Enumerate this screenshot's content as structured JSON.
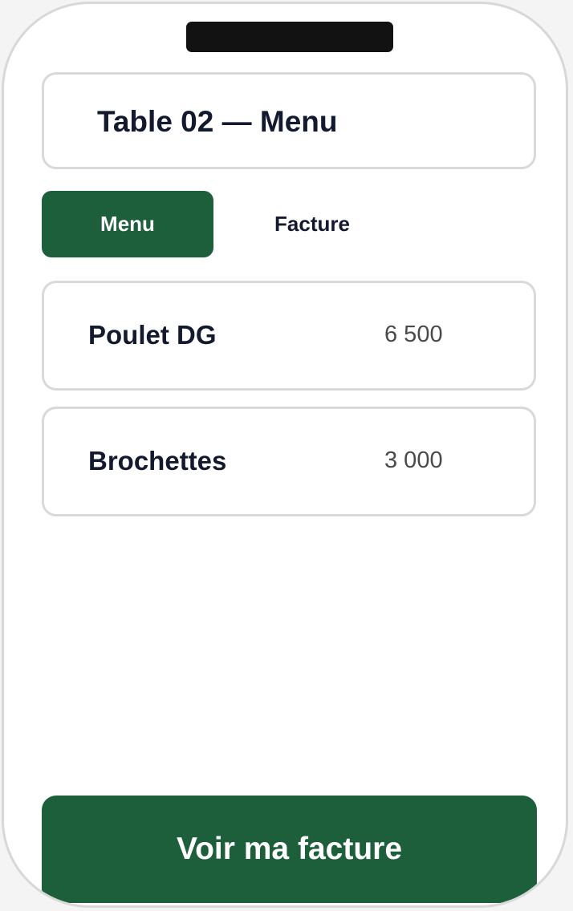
{
  "header": {
    "title": "Table 02 — Menu"
  },
  "tabs": [
    {
      "label": "Menu",
      "active": true
    },
    {
      "label": "Facture",
      "active": false
    }
  ],
  "menu": {
    "items": [
      {
        "name": "Poulet DG",
        "price": "6 500"
      },
      {
        "name": "Brochettes",
        "price": "3 000"
      }
    ]
  },
  "footer": {
    "cta_label": "Voir ma facture"
  },
  "colors": {
    "accent": "#1d5e3b",
    "text": "#13192e",
    "price_text": "#4a4a4a",
    "border": "#d9d9d9"
  }
}
